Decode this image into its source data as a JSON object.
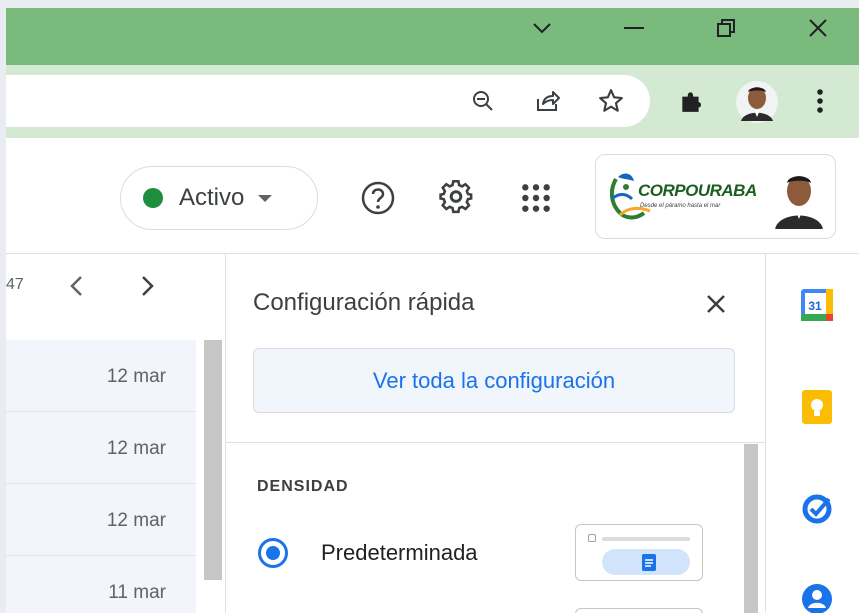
{
  "browser": {
    "window_controls": [
      "tab-search",
      "minimize",
      "restore",
      "close"
    ],
    "toolbar_icons": [
      "zoom-out-icon",
      "share-icon",
      "star-icon",
      "extensions-icon",
      "profile-avatar",
      "menu-icon"
    ],
    "colors": {
      "titlebar": "#7aba7c",
      "toolbar": "#d3e9d1"
    }
  },
  "header": {
    "status": {
      "label": "Activo",
      "color": "#1e8e3e"
    },
    "icons": [
      "help-icon",
      "settings-icon",
      "apps-grid-icon"
    ],
    "account": {
      "logo_text": "CORPOURABA",
      "logo_tagline": "Desde el páramo hasta el mar"
    }
  },
  "mail_list": {
    "count_fragment": "47",
    "rows": [
      {
        "date": "12 mar"
      },
      {
        "date": "12 mar"
      },
      {
        "date": "12 mar"
      },
      {
        "date": "11 mar"
      }
    ]
  },
  "quick_settings": {
    "title": "Configuración rápida",
    "see_all_label": "Ver toda la configuración",
    "density_section": "DENSIDAD",
    "density_options": [
      {
        "label": "Predeterminada",
        "selected": true
      }
    ],
    "accent_color": "#1a73e8"
  },
  "side_apps": {
    "calendar_day": "31",
    "apps": [
      "calendar-icon",
      "keep-icon",
      "tasks-icon",
      "contacts-icon"
    ]
  }
}
